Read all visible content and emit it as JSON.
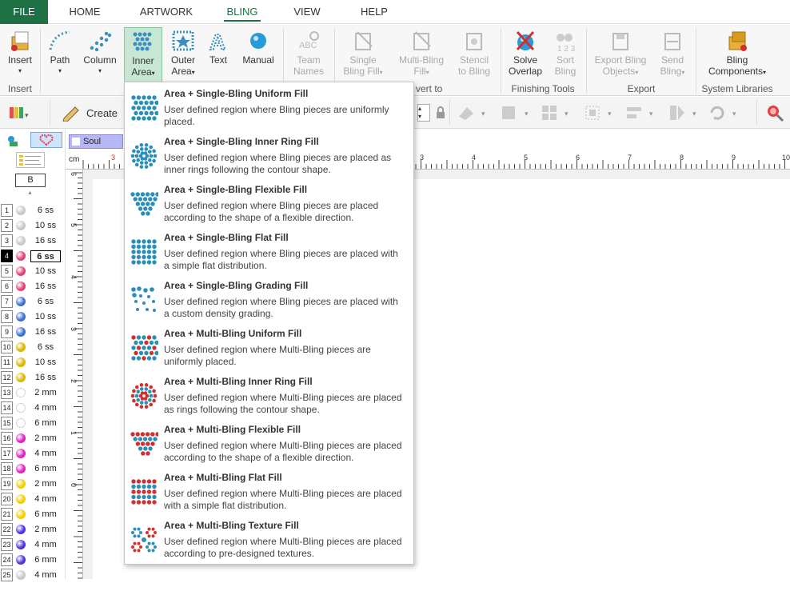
{
  "menu": {
    "file": "FILE",
    "tabs": [
      "HOME",
      "ARTWORK",
      "BLING",
      "VIEW",
      "HELP"
    ]
  },
  "ribbon": {
    "insert": {
      "label": "Insert",
      "group": "Insert"
    },
    "path": "Path",
    "column": "Column",
    "inner_area": [
      "Inner",
      "Area"
    ],
    "outer_area": [
      "Outer",
      "Area"
    ],
    "text": "Text",
    "manual": "Manual",
    "team_names": [
      "Team",
      "Names"
    ],
    "single_bling_fill": [
      "Single",
      "Bling Fill"
    ],
    "multi_bling_fill": [
      "Multi-Bling",
      "Fill"
    ],
    "stencil": [
      "Stencil",
      "to Bling"
    ],
    "convert_group": "vert to",
    "solve_overlap": [
      "Solve",
      "Overlap"
    ],
    "sort_bling": [
      "Sort",
      "Bling"
    ],
    "finishing_group": "Finishing Tools",
    "export_bling": [
      "Export Bling",
      "Objects"
    ],
    "send_bling": [
      "Send",
      "Bling"
    ],
    "export_group": "Export",
    "bling_components": [
      "Bling",
      "Components"
    ],
    "system_group": "System Libraries"
  },
  "toolbar2": {
    "create": "Create"
  },
  "tabstrip": {
    "b_label": "B",
    "soul_tab": "Soul"
  },
  "palette": [
    {
      "n": "1",
      "size": "6 ss",
      "color": "#c8c8c8"
    },
    {
      "n": "2",
      "size": "10 ss",
      "color": "#c8c8c8"
    },
    {
      "n": "3",
      "size": "16 ss",
      "color": "#c8c8c8"
    },
    {
      "n": "4",
      "size": "6 ss",
      "color": "#e0407a"
    },
    {
      "n": "5",
      "size": "10 ss",
      "color": "#e0407a"
    },
    {
      "n": "6",
      "size": "16 ss",
      "color": "#e0407a"
    },
    {
      "n": "7",
      "size": "6 ss",
      "color": "#3a6fd1"
    },
    {
      "n": "8",
      "size": "10 ss",
      "color": "#3a6fd1"
    },
    {
      "n": "9",
      "size": "16 ss",
      "color": "#3a6fd1"
    },
    {
      "n": "10",
      "size": "6 ss",
      "color": "#d8b800"
    },
    {
      "n": "11",
      "size": "10 ss",
      "color": "#d8b800"
    },
    {
      "n": "12",
      "size": "16 ss",
      "color": "#d8b800"
    },
    {
      "n": "13",
      "size": "2 mm",
      "color": "#ffffff"
    },
    {
      "n": "14",
      "size": "4 mm",
      "color": "#ffffff"
    },
    {
      "n": "15",
      "size": "6 mm",
      "color": "#ffffff"
    },
    {
      "n": "16",
      "size": "2 mm",
      "color": "#e020c0"
    },
    {
      "n": "17",
      "size": "4 mm",
      "color": "#e020c0"
    },
    {
      "n": "18",
      "size": "6 mm",
      "color": "#e020c0"
    },
    {
      "n": "19",
      "size": "2 mm",
      "color": "#f0d000"
    },
    {
      "n": "20",
      "size": "4 mm",
      "color": "#f0d000"
    },
    {
      "n": "21",
      "size": "6 mm",
      "color": "#f0d000"
    },
    {
      "n": "22",
      "size": "2 mm",
      "color": "#5030e0"
    },
    {
      "n": "23",
      "size": "4 mm",
      "color": "#5030e0"
    },
    {
      "n": "24",
      "size": "6 mm",
      "color": "#5030e0"
    },
    {
      "n": "25",
      "size": "4 mm",
      "color": "#c8c8c8"
    }
  ],
  "ruler": {
    "unit": "cm",
    "top": [
      "3",
      "3",
      "4",
      "5",
      "6",
      "7",
      "8",
      "9",
      "10"
    ],
    "left": [
      "6",
      "5",
      "4",
      "3",
      "2",
      "1",
      "0"
    ]
  },
  "dropdown": [
    {
      "title": "Area + Single-Bling Uniform Fill",
      "desc": "User defined region where Bling pieces are uniformly placed.",
      "icon": "uniform-fill-icon"
    },
    {
      "title": "Area + Single-Bling Inner Ring Fill",
      "desc": "User defined region where Bling pieces are placed as inner rings following the contour shape.",
      "icon": "inner-ring-fill-icon"
    },
    {
      "title": "Area + Single-Bling Flexible Fill",
      "desc": "User defined region where Bling pieces are placed according to the shape of a flexible direction.",
      "icon": "flexible-fill-icon"
    },
    {
      "title": "Area + Single-Bling Flat Fill",
      "desc": "User defined region where Bling pieces are placed with a simple flat distribution.",
      "icon": "flat-fill-icon"
    },
    {
      "title": "Area + Single-Bling Grading Fill",
      "desc": "User defined region where Bling pieces are placed with a custom density grading.",
      "icon": "grading-fill-icon"
    },
    {
      "title": "Area + Multi-Bling Uniform Fill",
      "desc": "User defined region where Multi-Bling pieces are uniformly placed.",
      "icon": "multi-uniform-fill-icon"
    },
    {
      "title": "Area + Multi-Bling Inner Ring Fill",
      "desc": "User defined region where Multi-Bling pieces are placed as rings following the contour shape.",
      "icon": "multi-inner-ring-fill-icon"
    },
    {
      "title": "Area + Multi-Bling Flexible Fill",
      "desc": "User defined region where Multi-Bling pieces are placed according to the shape of a flexible direction.",
      "icon": "multi-flexible-fill-icon"
    },
    {
      "title": "Area + Multi-Bling Flat Fill",
      "desc": "User defined region where Multi-Bling pieces are placed with a simple flat distribution.",
      "icon": "multi-flat-fill-icon"
    },
    {
      "title": "Area + Multi-Bling Texture Fill",
      "desc": "User defined region where Multi-Bling pieces are placed according to pre-designed textures.",
      "icon": "multi-texture-fill-icon"
    }
  ]
}
